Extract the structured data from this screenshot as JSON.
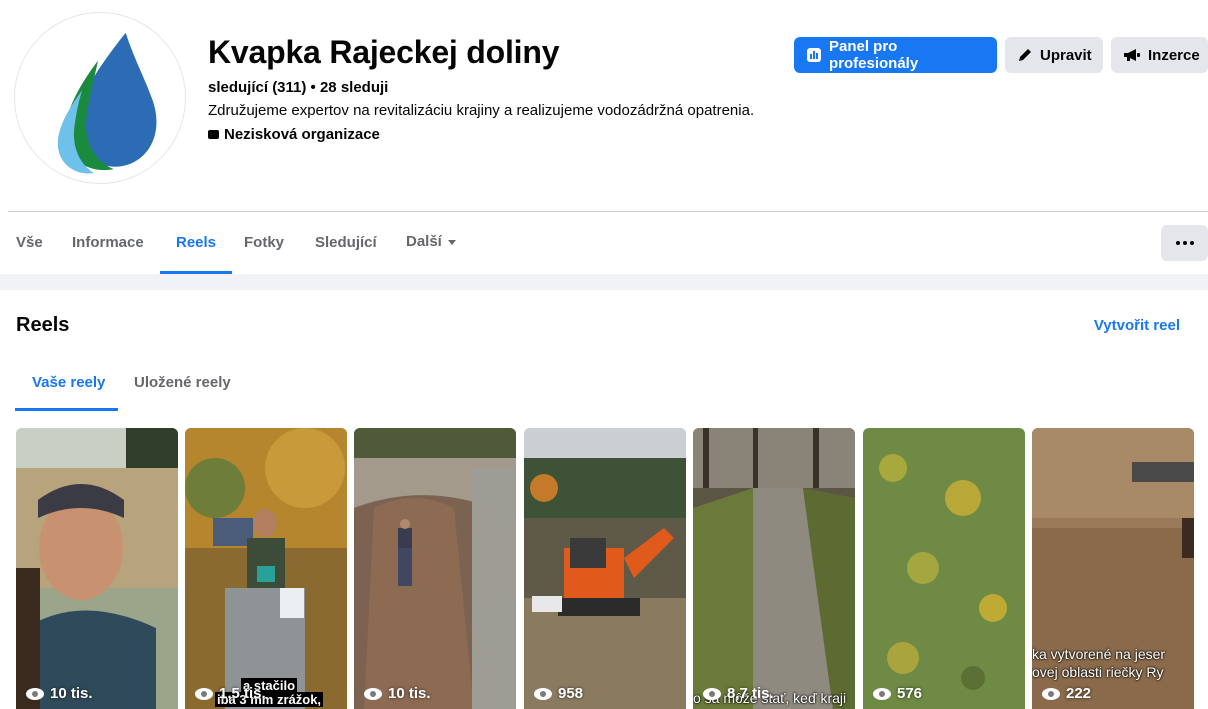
{
  "page": {
    "name": "Kvapka Rajeckej doliny",
    "followers": "sledující (311) • 28 sleduji",
    "description": "Združujeme expertov na revitalizáciu krajiny a realizujeme vodozádržná opatrenia.",
    "category": "Nezisková organizace"
  },
  "actions": {
    "dashboard": "Panel pro profesionály",
    "edit": "Upravit",
    "ads": "Inzerce"
  },
  "tabs": [
    "Vše",
    "Informace",
    "Reels",
    "Fotky",
    "Sledující",
    "Další"
  ],
  "active_tab": "Reels",
  "reels_section": {
    "title": "Reels",
    "create": "Vytvořit reel",
    "subtabs": [
      "Vaše reely",
      "Uložené reely"
    ]
  },
  "reels": [
    {
      "views": "10 tis."
    },
    {
      "views": "1,5 tis.",
      "caption_top": "a stačilo",
      "caption_bottom": "iba 3 mm zrážok,"
    },
    {
      "views": "10 tis."
    },
    {
      "views": "958"
    },
    {
      "views": "8,7 tis.",
      "caption": "o sa môže stať, keď kraji"
    },
    {
      "views": "576"
    },
    {
      "views": "222",
      "caption_line1": "ka vytvorené na jeser",
      "caption_line2": "ovej oblasti riečky Ry"
    }
  ],
  "colors": {
    "accent": "#1877f2",
    "secondary_button": "#e4e6eb",
    "text_secondary": "#65676b"
  }
}
